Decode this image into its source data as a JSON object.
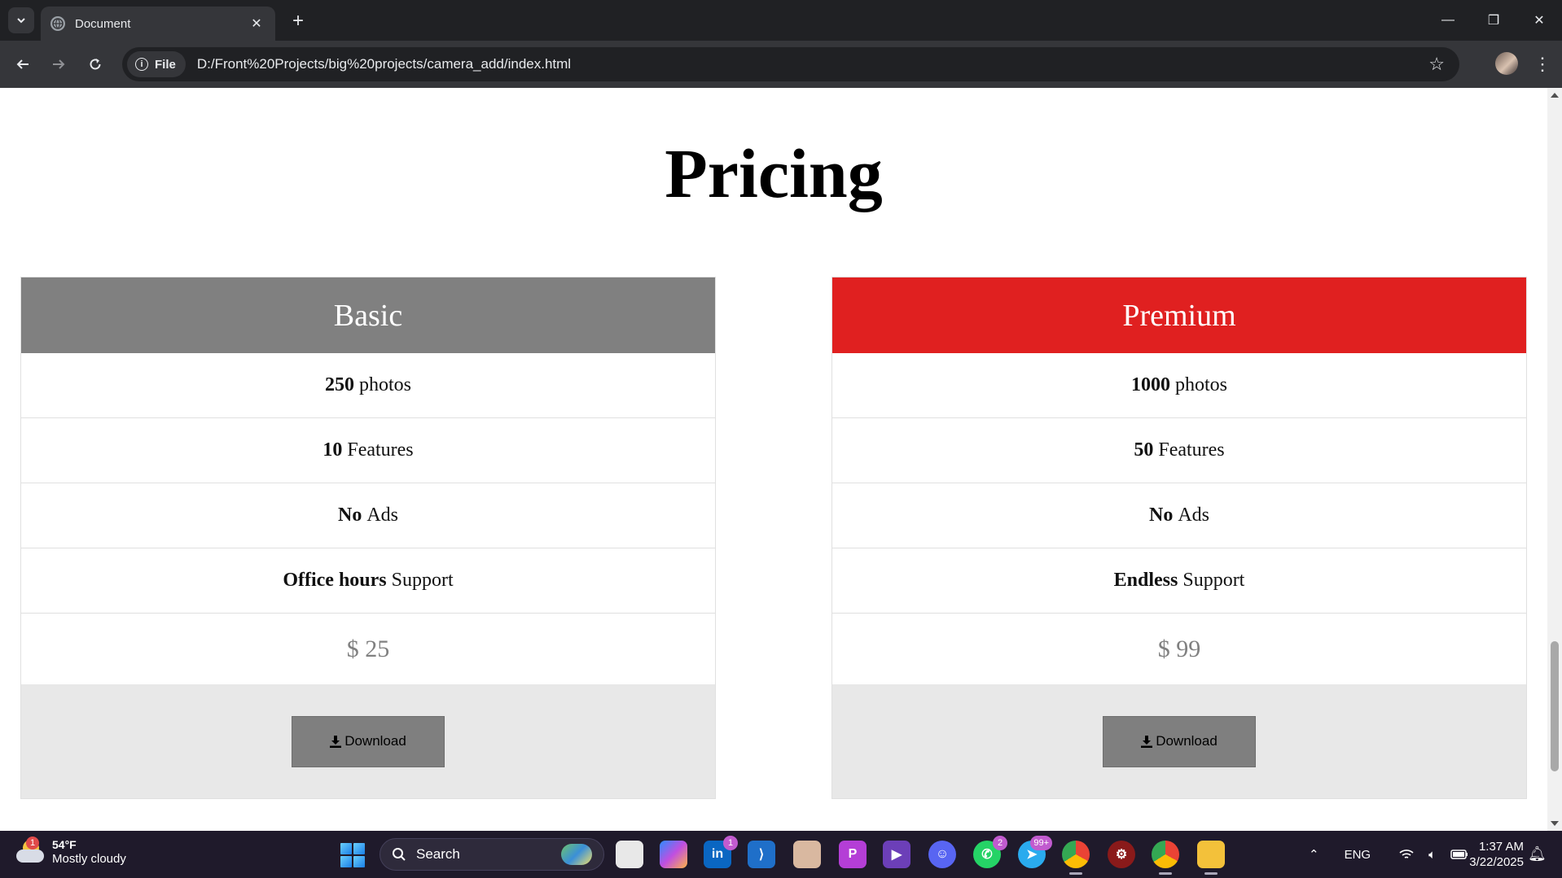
{
  "browser": {
    "tab_title": "Document",
    "site_chip": "File",
    "url": "D:/Front%20Projects/big%20projects/camera_add/index.html"
  },
  "page": {
    "title": "Pricing",
    "plans": [
      {
        "name": "Basic",
        "header_color": "#808080",
        "rows": [
          {
            "strong": "250",
            "text": "photos"
          },
          {
            "strong": "10",
            "text": "Features"
          },
          {
            "strong": "No",
            "text": "Ads"
          },
          {
            "strong": "Office hours",
            "text": "Support"
          }
        ],
        "price": "$ 25",
        "button_label": "Download"
      },
      {
        "name": "Premium",
        "header_color": "#e02020",
        "rows": [
          {
            "strong": "1000",
            "text": "photos"
          },
          {
            "strong": "50",
            "text": "Features"
          },
          {
            "strong": "No",
            "text": "Ads"
          },
          {
            "strong": "Endless",
            "text": "Support"
          }
        ],
        "price": "$ 99",
        "button_label": "Download"
      }
    ]
  },
  "taskbar": {
    "weather_badge": "1",
    "weather_temp": "54°F",
    "weather_desc": "Mostly cloudy",
    "search_label": "Search",
    "linkedin_badge": "1",
    "whatsapp_badge": "2",
    "telegram_badge": "99+",
    "language": "ENG",
    "time": "1:37 AM",
    "date": "3/22/2025"
  }
}
